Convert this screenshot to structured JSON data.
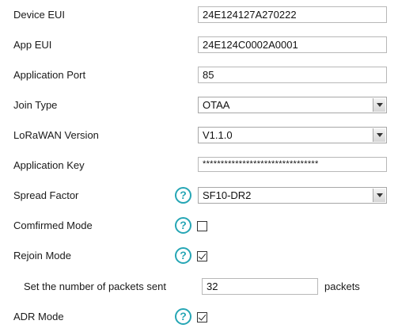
{
  "form": {
    "device_eui": {
      "label": "Device EUI",
      "value": "24E124127A270222"
    },
    "app_eui": {
      "label": "App EUI",
      "value": "24E124C0002A0001"
    },
    "application_port": {
      "label": "Application Port",
      "value": "85"
    },
    "join_type": {
      "label": "Join Type",
      "value": "OTAA"
    },
    "lorawan_version": {
      "label": "LoRaWAN Version",
      "value": "V1.1.0"
    },
    "application_key": {
      "label": "Application Key",
      "value": "********************************"
    },
    "spread_factor": {
      "label": "Spread Factor",
      "value": "SF10-DR2",
      "help": "?"
    },
    "confirmed_mode": {
      "label": "Comfirmed Mode",
      "checked": false,
      "help": "?"
    },
    "rejoin_mode": {
      "label": "Rejoin Mode",
      "checked": true,
      "help": "?"
    },
    "packets_sent": {
      "label": "Set the number of packets sent",
      "value": "32",
      "unit": "packets"
    },
    "adr_mode": {
      "label": "ADR Mode",
      "checked": true,
      "help": "?"
    }
  },
  "colors": {
    "help_icon": "#26a6b5",
    "input_border": "#b8b8b8"
  }
}
